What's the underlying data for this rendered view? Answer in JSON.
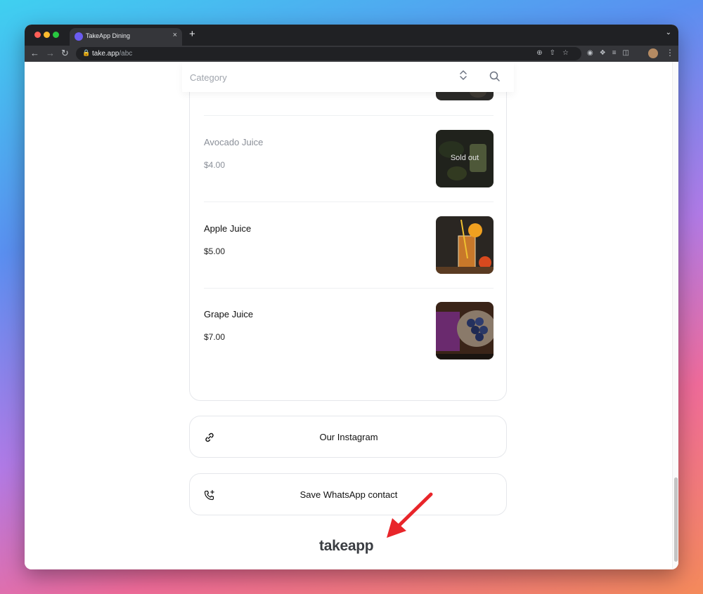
{
  "browser": {
    "tab_title": "TakeApp Dining",
    "tab_close": "×",
    "new_tab": "+",
    "url_host": "take.app",
    "url_path": "/abc"
  },
  "menu": {
    "category_placeholder": "Category",
    "items": [
      {
        "name": "Avocado Juice",
        "price": "$4.00",
        "sold_out": true,
        "sold_out_label": "Sold out"
      },
      {
        "name": "Apple Juice",
        "price": "$5.00",
        "sold_out": false
      },
      {
        "name": "Grape Juice",
        "price": "$7.00",
        "sold_out": false
      }
    ]
  },
  "links": {
    "instagram_label": "Our Instagram",
    "whatsapp_label": "Save WhatsApp contact"
  },
  "footer": {
    "brand": "takeapp"
  },
  "colors": {
    "annotation_arrow": "#e8252a",
    "brand_tab_icon": "#6b5cf0"
  }
}
